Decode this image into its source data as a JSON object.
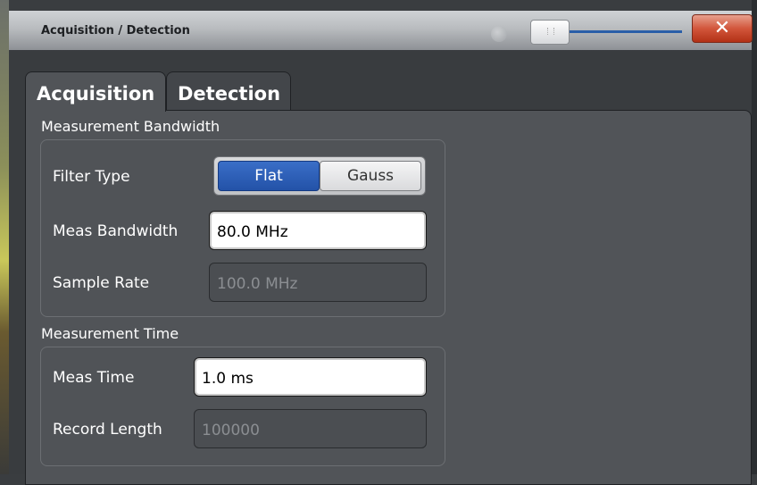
{
  "window": {
    "title": "Acquisition / Detection",
    "close_glyph": "✕"
  },
  "tabs": [
    {
      "label": "Acquisition",
      "active": true
    },
    {
      "label": "Detection",
      "active": false
    }
  ],
  "measurement_bandwidth": {
    "title": "Measurement Bandwidth",
    "filter_type": {
      "label": "Filter Type",
      "options": [
        "Flat",
        "Gauss"
      ],
      "selected": "Flat"
    },
    "meas_bandwidth": {
      "label": "Meas Bandwidth",
      "value": "80.0 MHz"
    },
    "sample_rate": {
      "label": "Sample Rate",
      "value": "100.0 MHz"
    }
  },
  "measurement_time": {
    "title": "Measurement Time",
    "meas_time": {
      "label": "Meas Time",
      "value": "1.0 ms"
    },
    "record_length": {
      "label": "Record Length",
      "value": "100000"
    }
  },
  "colors": {
    "selected_toggle": "#2a5ea8",
    "close_button": "#c8472b"
  }
}
